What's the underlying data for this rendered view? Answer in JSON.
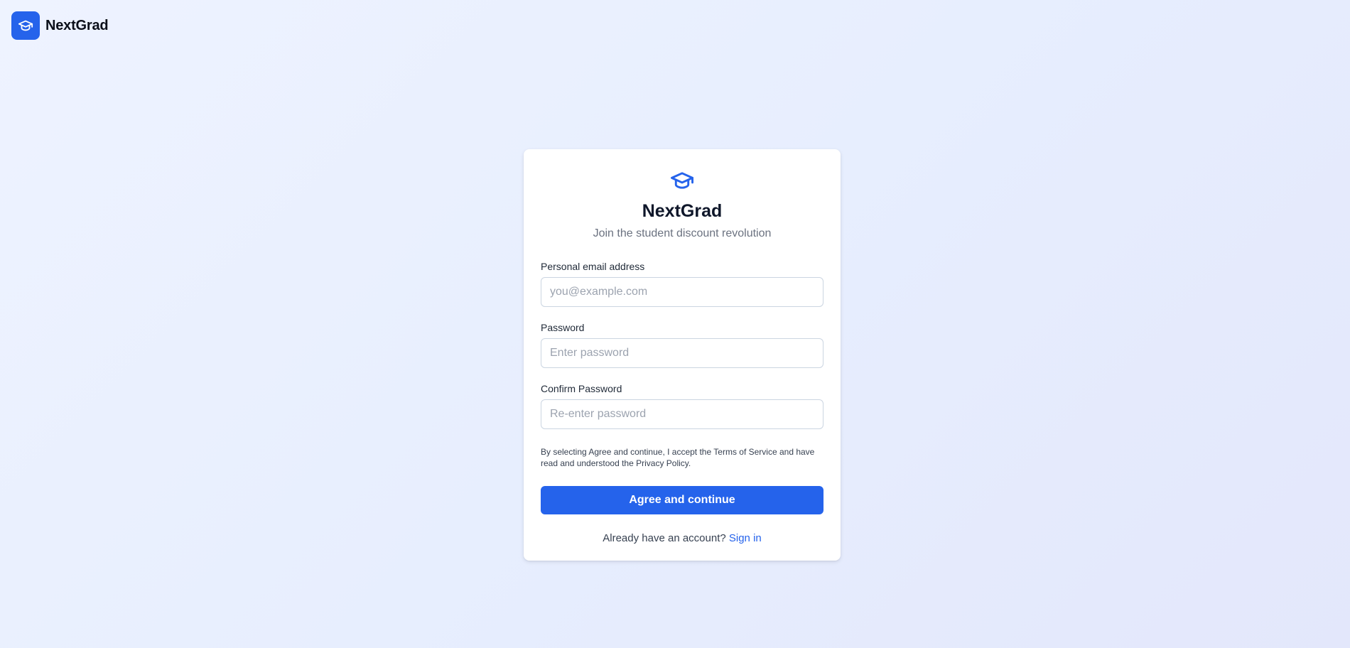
{
  "header": {
    "brand_name": "NextGrad",
    "logo_icon": "graduation-cap-icon"
  },
  "card": {
    "icon": "graduation-cap-icon",
    "title": "NextGrad",
    "subtitle": "Join the student discount revolution",
    "fields": [
      {
        "label": "Personal email address",
        "placeholder": "you@example.com",
        "value": ""
      },
      {
        "label": "Password",
        "placeholder": "Enter password",
        "value": ""
      },
      {
        "label": "Confirm Password",
        "placeholder": "Re-enter password",
        "value": ""
      }
    ],
    "legal_text": "By selecting Agree and continue, I accept the Terms of Service and have read and understood the Privacy Policy.",
    "submit_label": "Agree and continue",
    "signin_prompt": "Already have an account?",
    "signin_link": "Sign in"
  },
  "colors": {
    "accent": "#2563eb",
    "background": "#eaf0fe",
    "card": "#ffffff",
    "muted_text": "#6b7280"
  }
}
